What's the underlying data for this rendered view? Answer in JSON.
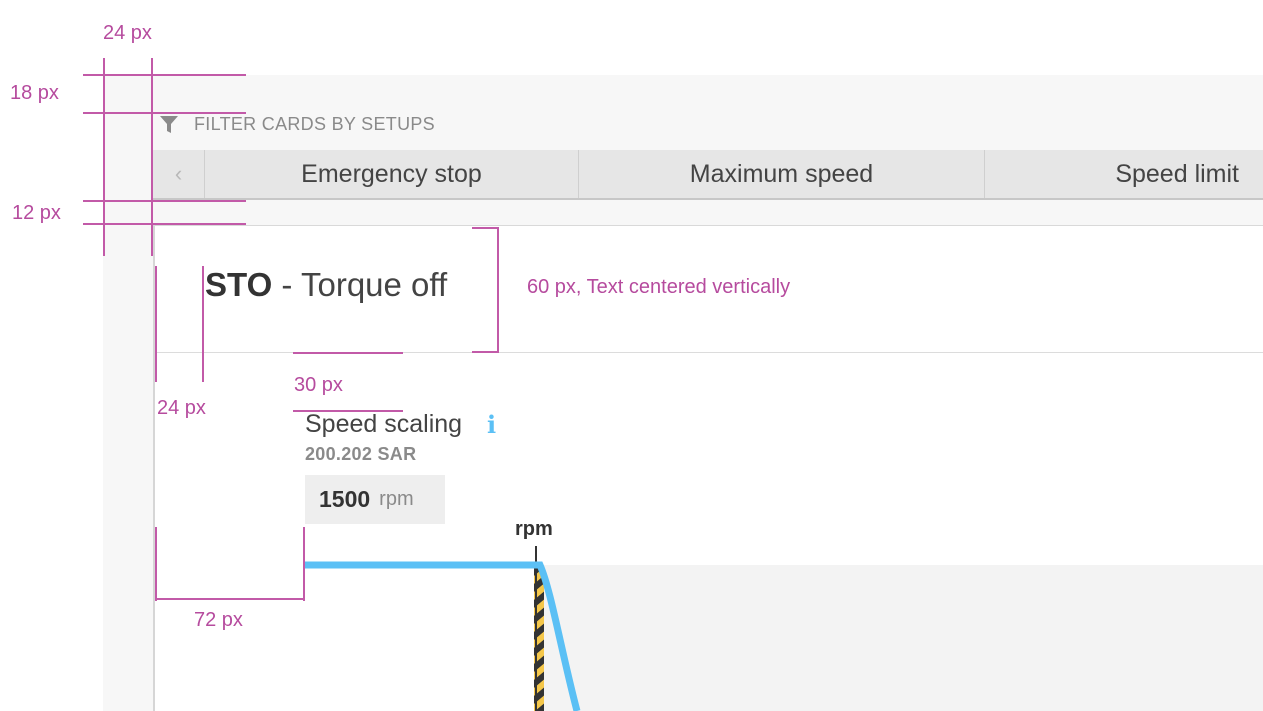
{
  "filter": {
    "label": "FILTER CARDS BY SETUPS",
    "icon": "funnel-icon"
  },
  "tabs": {
    "prev_icon": "chevron-left-icon",
    "prev_glyph": "‹",
    "items": [
      {
        "label": "Emergency stop"
      },
      {
        "label": "Maximum speed"
      },
      {
        "label": "Speed limit"
      }
    ]
  },
  "card": {
    "title_abbr": "STO",
    "title_rest": " - Torque off"
  },
  "param": {
    "label": "Speed scaling",
    "info_icon": "info-icon",
    "info_glyph": "i",
    "sublabel": "200.202 SAR",
    "value": "1500",
    "unit": "rpm"
  },
  "chart": {
    "axis_label": "rpm",
    "line_color": "#5bc0f5",
    "hazard_colors": [
      "#f5c74a",
      "#333333"
    ]
  },
  "annotations": {
    "a24_top": "24 px",
    "a18": "18 px",
    "a12": "12 px",
    "a60": "60 px, Text centered vertically",
    "a24_card": "24 px",
    "a30": "30 px",
    "a72": "72 px",
    "color": "#b64b9e"
  }
}
